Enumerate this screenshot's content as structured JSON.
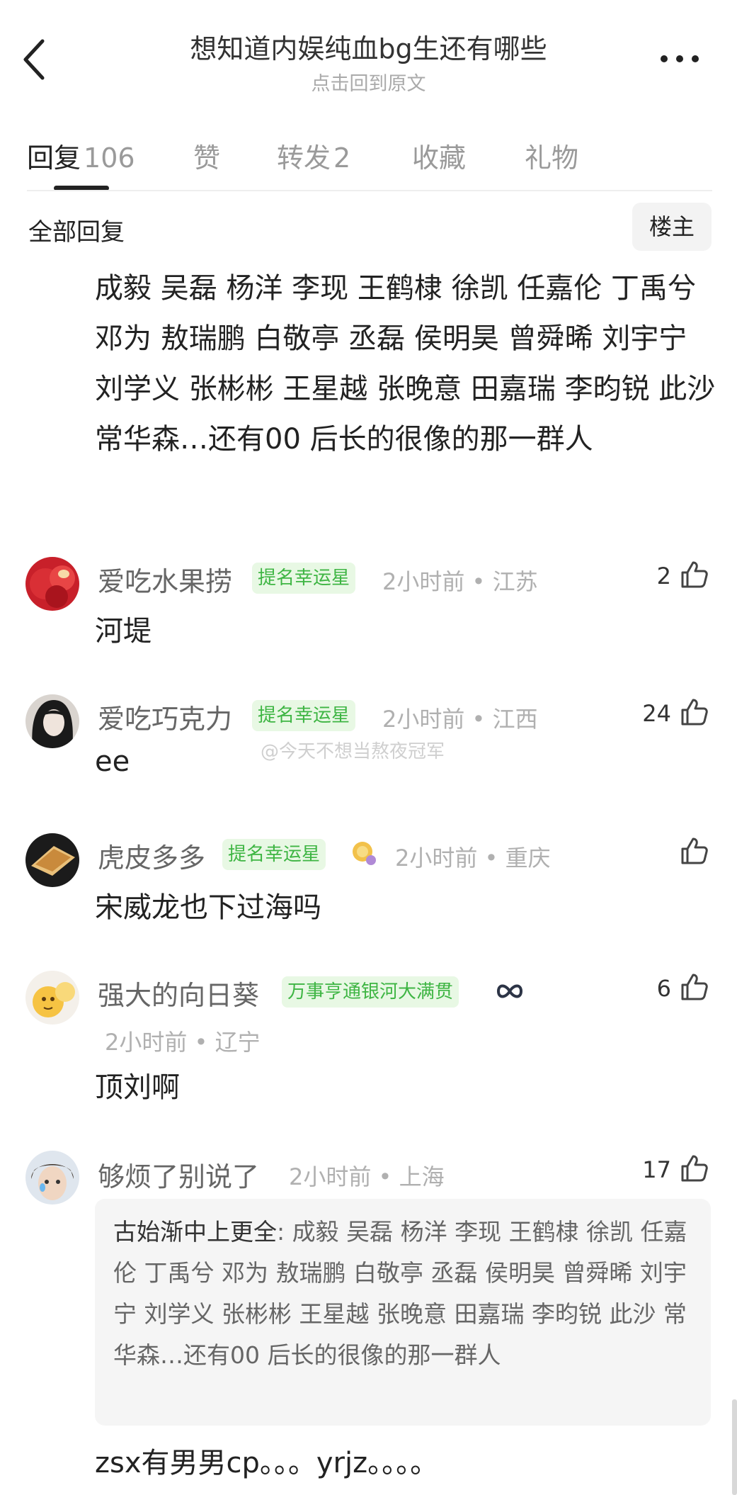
{
  "header": {
    "title": "想知道内娱纯血bg生还有哪些",
    "subtitle": "点击回到原文"
  },
  "tabs": [
    {
      "label": "回复",
      "count": "106"
    },
    {
      "label": "赞"
    },
    {
      "label": "转发",
      "count": "2"
    },
    {
      "label": "收藏"
    },
    {
      "label": "礼物"
    }
  ],
  "section": {
    "title": "全部回复",
    "owner_button": "楼主"
  },
  "main_reply": {
    "text": "成毅 吴磊 杨洋 李现 王鹤棣 徐凯  任嘉伦 丁禹兮 邓为 敖瑞鹏 白敬亭 丞磊 侯明昊 曾舜晞 刘宇宁 刘学义 张彬彬 王星越 张晚意 田嘉瑞 李昀锐 此沙 常华森…还有00 后长的很像的那一群人"
  },
  "watermark": "@今天不想当熬夜冠军",
  "comments": [
    {
      "name": "爱吃水果捞",
      "badge": "提名幸运星",
      "time": "2小时前",
      "location": "江苏",
      "likes": "2",
      "text": "河堤"
    },
    {
      "name": "爱吃巧克力",
      "badge": "提名幸运星",
      "time": "2小时前",
      "location": "江西",
      "likes": "24",
      "text": "ee"
    },
    {
      "name": "虎皮多多",
      "badge": "提名幸运星",
      "time": "2小时前",
      "location": "重庆",
      "likes": "",
      "text": "宋威龙也下过海吗"
    },
    {
      "name": "强大的向日葵",
      "badge": "万事亨通银河大满贯",
      "time": "2小时前",
      "location": "辽宁",
      "likes": "6",
      "text": "顶刘啊"
    },
    {
      "name": "够烦了别说了",
      "time": "2小时前",
      "location": "上海",
      "likes": "17",
      "quote_author": "古始渐中上更全",
      "quote_text": ": 成毅 吴磊 杨洋 李现 王鹤棣 徐凯 任嘉伦 丁禹兮 邓为 敖瑞鹏 白敬亭 丞磊 侯明昊 曾舜晞 刘宇宁 刘学义 张彬彬 王星越 张晚意 田嘉瑞 李昀锐 此沙 常华森…还有00 后长的很像的那一群人",
      "text": "zsx有男男cp。。。yrjz。。。。"
    }
  ],
  "colors": {
    "badge_green": "#3eb543",
    "badge_bg": "#e8f8e4",
    "meta_gray": "#b0b0b0"
  }
}
